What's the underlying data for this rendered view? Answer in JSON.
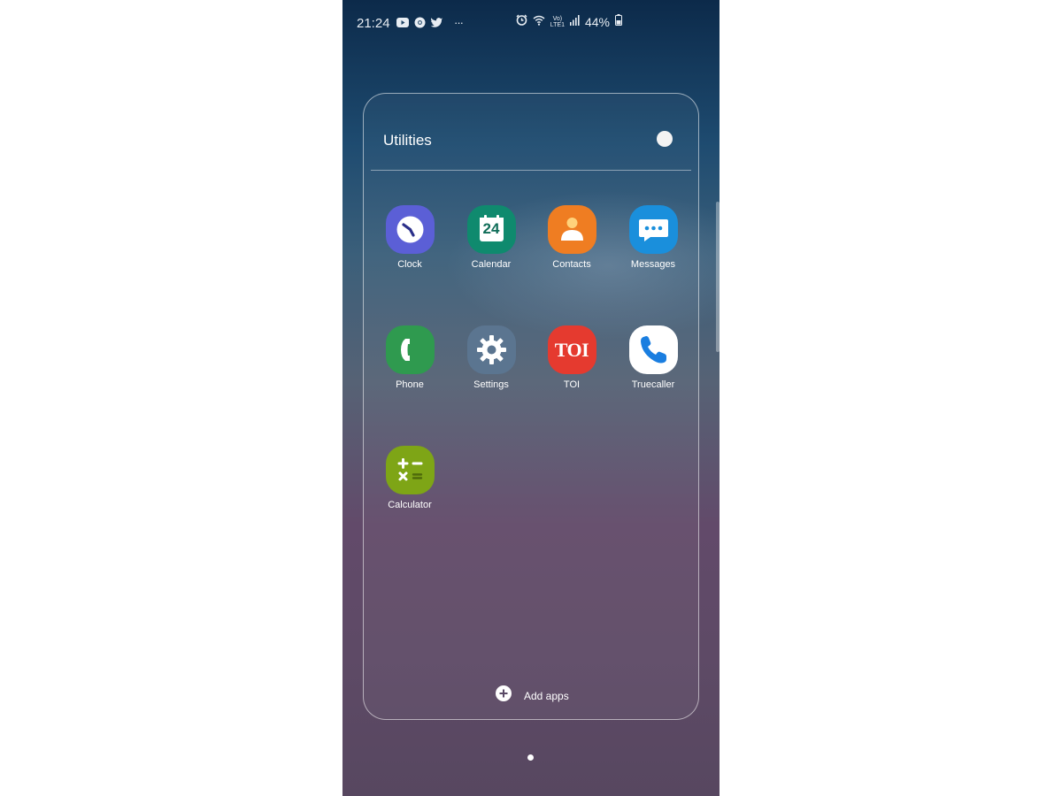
{
  "status_bar": {
    "time": "21:24",
    "notification_icons": [
      "youtube-icon",
      "chrome-icon",
      "twitter-icon",
      "more-dots-icon"
    ],
    "more_indicator": "···",
    "system_icons": [
      "alarm-icon",
      "wifi-icon",
      "volte-icon",
      "signal-icon",
      "battery-icon"
    ],
    "volte_line1": "Vo)",
    "volte_line2": "LTE1",
    "battery": "44%"
  },
  "folder": {
    "title": "Utilities",
    "color_dot": "#f3f3f3",
    "apps": [
      {
        "label": "Clock",
        "icon": "clock-icon",
        "color": "#5b5fd6"
      },
      {
        "label": "Calendar",
        "icon": "calendar-icon",
        "color": "#0f8a6e",
        "date": "24"
      },
      {
        "label": "Contacts",
        "icon": "contacts-icon",
        "color": "#ef7d22"
      },
      {
        "label": "Messages",
        "icon": "messages-icon",
        "color": "#1a8fdc"
      },
      {
        "label": "Phone",
        "icon": "phone-icon",
        "color": "#2f9a4f"
      },
      {
        "label": "Settings",
        "icon": "settings-icon",
        "color": "#5b7590"
      },
      {
        "label": "TOI",
        "icon": "toi-icon",
        "color": "#e53a2f",
        "text": "TOI"
      },
      {
        "label": "Truecaller",
        "icon": "truecaller-icon",
        "color": "#ffffff"
      },
      {
        "label": "Calculator",
        "icon": "calculator-icon",
        "color": "#7ea516"
      }
    ],
    "add_apps": "Add apps"
  }
}
